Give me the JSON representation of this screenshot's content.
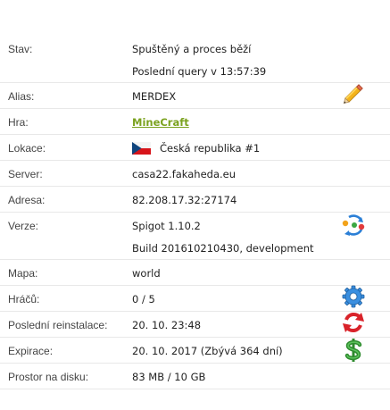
{
  "rows": {
    "status": {
      "label": "Stav:",
      "value": "Spuštěný a proces běží",
      "sub": "Poslední query v 13:57:39"
    },
    "alias": {
      "label": "Alias:",
      "value": "MERDEX",
      "action_icon": "pencil-edit-icon"
    },
    "game": {
      "label": "Hra:",
      "value": "MineCraft"
    },
    "location": {
      "label": "Lokace:",
      "value": "Česká republika #1",
      "flag_icon": "czech-flag-icon"
    },
    "server": {
      "label": "Server:",
      "value": "casa22.fakaheda.eu"
    },
    "address": {
      "label": "Adresa:",
      "value": "82.208.17.32:27174"
    },
    "version": {
      "label": "Verze:",
      "value": "Spigot 1.10.2",
      "sub": "Build 201610210430, development",
      "action_icon": "refresh-cycle-icon"
    },
    "map": {
      "label": "Mapa:",
      "value": "world"
    },
    "players": {
      "label": "Hráčů:",
      "value": "0 / 5",
      "action_icon": "gear-icon"
    },
    "reinstall": {
      "label": "Poslední reinstalace:",
      "value": "20. 10. 23:48",
      "action_icon": "reinstall-icon"
    },
    "expiry": {
      "label": "Expirace:",
      "value": "20. 10. 2017 (Zbývá 364 dní)",
      "action_icon": "dollar-icon"
    },
    "disk": {
      "label": "Prostor na disku:",
      "value": "83 MB / 10 GB"
    }
  },
  "colors": {
    "label": "#444444",
    "value": "#222222",
    "link": "#7ba21f",
    "divider": "#e8e8e8"
  }
}
